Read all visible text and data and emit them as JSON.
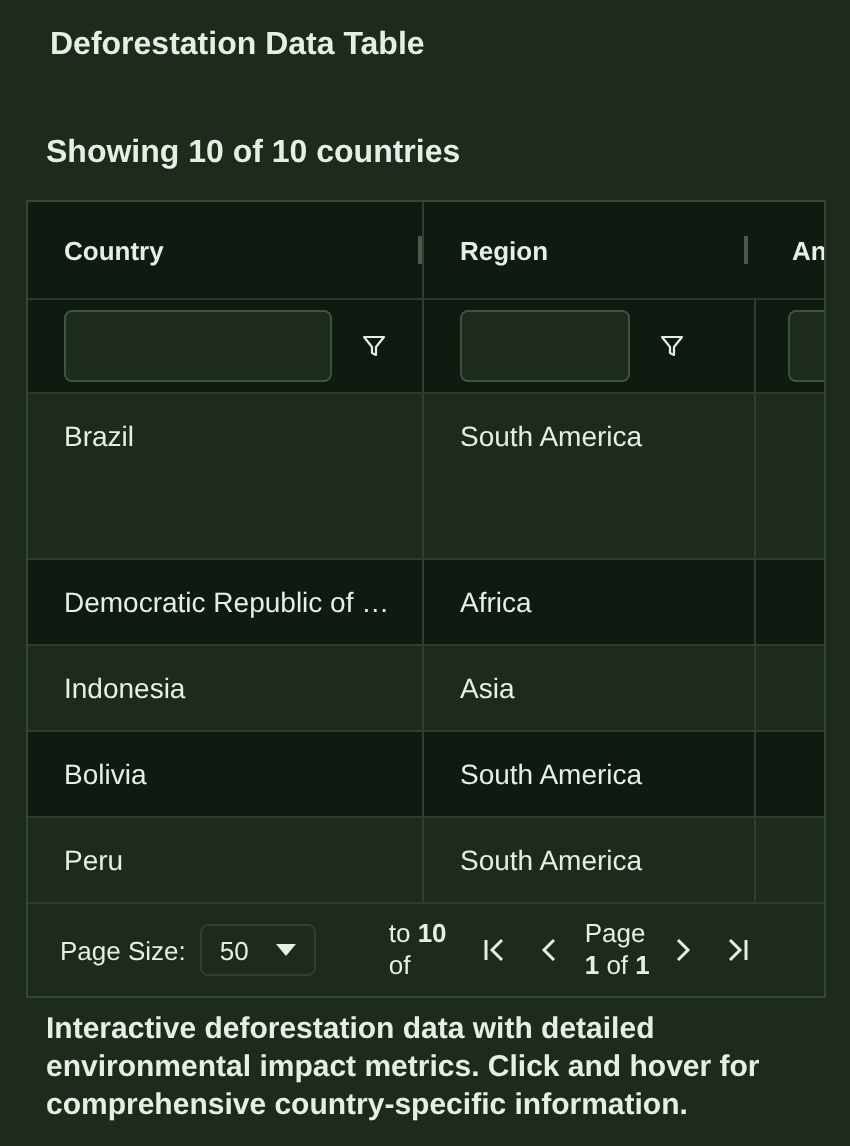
{
  "title": "Deforestation Data Table",
  "summary": "Showing 10 of 10 countries",
  "table": {
    "columns": [
      {
        "label": "Country"
      },
      {
        "label": "Region"
      },
      {
        "label": "An"
      }
    ],
    "rows": [
      [
        "Brazil",
        "South America"
      ],
      [
        "Democratic Republic of …",
        "Africa"
      ],
      [
        "Indonesia",
        "Asia"
      ],
      [
        "Bolivia",
        "South America"
      ],
      [
        "Peru",
        "South America"
      ]
    ]
  },
  "pagination": {
    "page_size_label": "Page Size:",
    "page_size": "50",
    "range": "to **10** of",
    "page": "Page **1** of **1**"
  },
  "description": "Interactive deforestation data with detailed environmental impact metrics. Click and hover for comprehensive country-specific information."
}
